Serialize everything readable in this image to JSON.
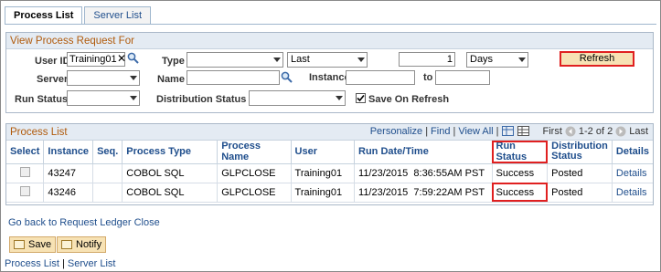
{
  "tabs": [
    {
      "label": "Process List",
      "active": true
    },
    {
      "label": "Server List",
      "active": false
    }
  ],
  "request": {
    "header": "View Process Request For",
    "user_id_label": "User ID",
    "user_id_value": "Training01",
    "type_label": "Type",
    "type_value": "",
    "period_value": "Last",
    "period_count": "1",
    "period_unit": "Days",
    "refresh_label": "Refresh",
    "server_label": "Server",
    "server_value": "",
    "name_label": "Name",
    "name_value": "",
    "instance_label": "Instance",
    "instance_from": "",
    "to_label": "to",
    "instance_to": "",
    "run_status_label": "Run Status",
    "run_status_value": "",
    "dist_status_label": "Distribution Status",
    "dist_status_value": "",
    "save_on_refresh_label": "Save On Refresh",
    "save_on_refresh_checked": true
  },
  "grid": {
    "title": "Process List",
    "personalize": "Personalize",
    "find": "Find",
    "view_all": "View All",
    "first": "First",
    "range": "1-2 of 2",
    "last": "Last",
    "columns": [
      "Select",
      "Instance",
      "Seq.",
      "Process Type",
      "Process Name",
      "User",
      "Run Date/Time",
      "Run Status",
      "Distribution Status",
      "Details"
    ],
    "rows": [
      {
        "instance": "43247",
        "seq": "",
        "type": "COBOL SQL",
        "name": "GLPCLOSE",
        "user": "Training01",
        "date": "11/23/2015",
        "time": "8:36:55AM PST",
        "status": "Success",
        "dist": "Posted",
        "details": "Details"
      },
      {
        "instance": "43246",
        "seq": "",
        "type": "COBOL SQL",
        "name": "GLPCLOSE",
        "user": "Training01",
        "date": "11/23/2015",
        "time": "7:59:22AM PST",
        "status": "Success",
        "dist": "Posted",
        "details": "Details"
      }
    ]
  },
  "footer": {
    "go_back": "Go back to Request Ledger Close",
    "save": "Save",
    "notify": "Notify",
    "link_process_list": "Process List",
    "separator": "|",
    "link_server_list": "Server List"
  },
  "colors": {
    "highlight": "#e02020",
    "link": "#1f4e8c",
    "header_text": "#b05a0b",
    "button_bg": "#f7e2b4"
  }
}
